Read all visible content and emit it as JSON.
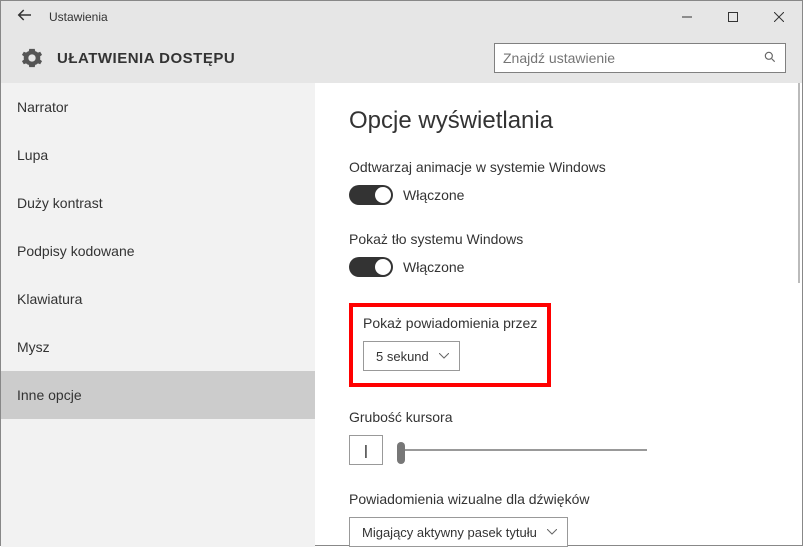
{
  "titlebar": {
    "title": "Ustawienia"
  },
  "header": {
    "title": "UŁATWIENIA DOSTĘPU",
    "search_placeholder": "Znajdź ustawienie"
  },
  "sidebar": {
    "items": [
      {
        "label": "Narrator"
      },
      {
        "label": "Lupa"
      },
      {
        "label": "Duży kontrast"
      },
      {
        "label": "Podpisy kodowane"
      },
      {
        "label": "Klawiatura"
      },
      {
        "label": "Mysz"
      },
      {
        "label": "Inne opcje"
      }
    ]
  },
  "main": {
    "heading": "Opcje wyświetlania",
    "animations": {
      "label": "Odtwarzaj animacje w systemie Windows",
      "state": "Włączone"
    },
    "background": {
      "label": "Pokaż tło systemu Windows",
      "state": "Włączone"
    },
    "notifications": {
      "label": "Pokaż powiadomienia przez",
      "value": "5 sekund"
    },
    "cursor": {
      "label": "Grubość kursora",
      "preview": "|"
    },
    "visualalert": {
      "label": "Powiadomienia wizualne dla dźwięków",
      "value": "Migający aktywny pasek tytułu"
    }
  }
}
